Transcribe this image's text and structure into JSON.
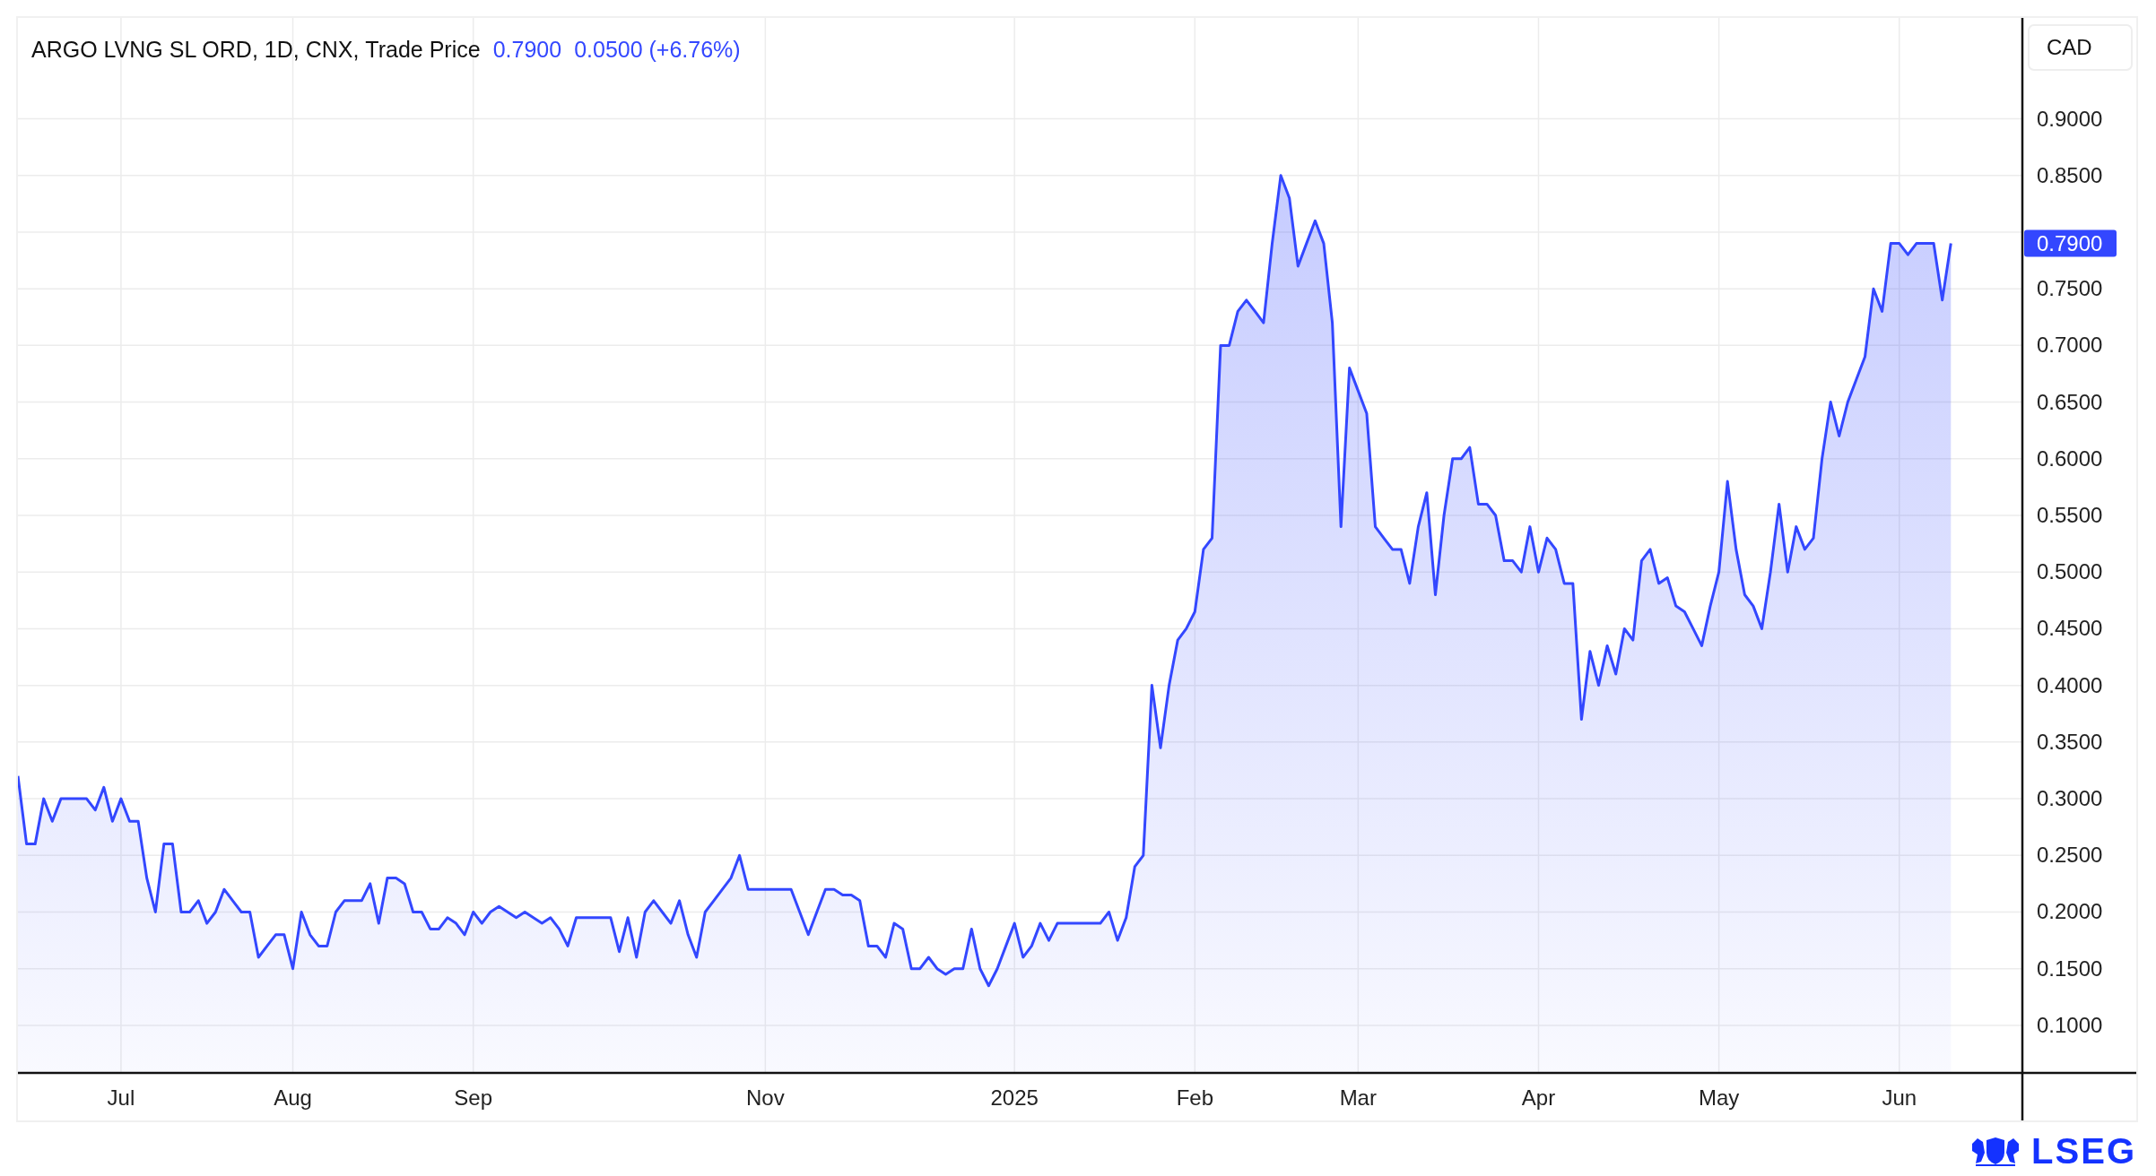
{
  "header": {
    "title": "ARGO LVNG SL ORD, 1D, CNX,",
    "last": "0.7900",
    "change": "0.0500 (+6.76%)"
  },
  "currency": "CAD",
  "price_label": "0.7900",
  "chart_data": {
    "type": "area",
    "grid": true,
    "ylim": [
      0.058,
      0.989
    ],
    "categories": [
      null,
      null,
      null,
      null,
      null,
      null,
      null,
      null,
      null,
      null,
      null,
      null,
      "Jul",
      null,
      null,
      null,
      null,
      null,
      null,
      null,
      null,
      null,
      null,
      null,
      null,
      null,
      null,
      null,
      null,
      null,
      null,
      null,
      "Aug",
      null,
      null,
      null,
      null,
      null,
      null,
      null,
      null,
      null,
      null,
      null,
      null,
      null,
      null,
      null,
      null,
      null,
      null,
      null,
      null,
      "Sep",
      null,
      null,
      null,
      null,
      null,
      null,
      null,
      null,
      null,
      null,
      null,
      null,
      null,
      null,
      null,
      null,
      null,
      null,
      null,
      null,
      null,
      null,
      null,
      null,
      null,
      null,
      null,
      null,
      null,
      null,
      null,
      null,
      null,
      "Nov",
      null,
      null,
      null,
      null,
      null,
      null,
      null,
      null,
      null,
      null,
      null,
      null,
      null,
      null,
      null,
      null,
      null,
      null,
      null,
      null,
      null,
      null,
      null,
      null,
      null,
      null,
      null,
      null,
      "2025",
      null,
      null,
      null,
      null,
      null,
      null,
      null,
      null,
      null,
      null,
      null,
      null,
      null,
      null,
      null,
      null,
      null,
      null,
      null,
      null,
      "Feb",
      null,
      null,
      null,
      null,
      null,
      null,
      null,
      null,
      null,
      null,
      null,
      null,
      null,
      null,
      null,
      null,
      null,
      null,
      "Mar",
      null,
      null,
      null,
      null,
      null,
      null,
      null,
      null,
      null,
      null,
      null,
      null,
      null,
      null,
      null,
      null,
      null,
      null,
      null,
      null,
      "Apr",
      null,
      null,
      null,
      null,
      null,
      null,
      null,
      null,
      null,
      null,
      null,
      null,
      null,
      null,
      null,
      null,
      null,
      null,
      null,
      null,
      "May",
      null,
      null,
      null,
      null,
      null,
      null,
      null,
      null,
      null,
      null,
      null,
      null,
      null,
      null,
      null,
      null,
      null,
      null,
      null,
      null,
      "Jun",
      null,
      null,
      null,
      null,
      null,
      null
    ],
    "yticks": [
      {
        "value": 0.1,
        "label": "0.1000"
      },
      {
        "value": 0.15,
        "label": "0.1500"
      },
      {
        "value": 0.2,
        "label": "0.2000"
      },
      {
        "value": 0.25,
        "label": "0.2500"
      },
      {
        "value": 0.3,
        "label": "0.3000"
      },
      {
        "value": 0.35,
        "label": "0.3500"
      },
      {
        "value": 0.4,
        "label": "0.4000"
      },
      {
        "value": 0.45,
        "label": "0.4500"
      },
      {
        "value": 0.5,
        "label": "0.5000"
      },
      {
        "value": 0.55,
        "label": "0.5500"
      },
      {
        "value": 0.6,
        "label": "0.6000"
      },
      {
        "value": 0.65,
        "label": "0.6500"
      },
      {
        "value": 0.7,
        "label": "0.7000"
      },
      {
        "value": 0.75,
        "label": "0.7500"
      },
      {
        "value": 0.85,
        "label": "0.8500"
      },
      {
        "value": 0.9,
        "label": "0.9000"
      }
    ],
    "series": [
      {
        "name": "Trade Price",
        "color": "#3347ff",
        "values": [
          0.32,
          0.26,
          0.26,
          0.3,
          0.28,
          0.3,
          0.3,
          0.3,
          0.3,
          0.29,
          0.31,
          0.28,
          0.3,
          0.28,
          0.28,
          0.23,
          0.2,
          0.26,
          0.26,
          0.2,
          0.2,
          0.21,
          0.19,
          0.2,
          0.22,
          0.21,
          0.2,
          0.2,
          0.16,
          0.17,
          0.18,
          0.18,
          0.15,
          0.2,
          0.18,
          0.17,
          0.17,
          0.2,
          0.21,
          0.21,
          0.21,
          0.225,
          0.19,
          0.23,
          0.23,
          0.225,
          0.2,
          0.2,
          0.185,
          0.185,
          0.195,
          0.19,
          0.18,
          0.2,
          0.19,
          0.2,
          0.205,
          0.2,
          0.195,
          0.2,
          0.195,
          0.19,
          0.195,
          0.185,
          0.17,
          0.195,
          0.195,
          0.195,
          0.195,
          0.195,
          0.165,
          0.195,
          0.16,
          0.2,
          0.21,
          0.2,
          0.19,
          0.21,
          0.18,
          0.16,
          0.2,
          0.21,
          0.22,
          0.23,
          0.25,
          0.22,
          0.22,
          0.22,
          0.22,
          0.22,
          0.22,
          0.2,
          0.18,
          0.2,
          0.22,
          0.22,
          0.215,
          0.215,
          0.21,
          0.17,
          0.17,
          0.16,
          0.19,
          0.185,
          0.15,
          0.15,
          0.16,
          0.15,
          0.145,
          0.15,
          0.15,
          0.185,
          0.15,
          0.135,
          0.15,
          0.17,
          0.19,
          0.16,
          0.17,
          0.19,
          0.175,
          0.19,
          0.19,
          0.19,
          0.19,
          0.19,
          0.19,
          0.2,
          0.175,
          0.195,
          0.24,
          0.25,
          0.4,
          0.345,
          0.4,
          0.44,
          0.45,
          0.465,
          0.52,
          0.53,
          0.7,
          0.7,
          0.73,
          0.74,
          0.73,
          0.72,
          0.79,
          0.85,
          0.83,
          0.77,
          0.79,
          0.81,
          0.79,
          0.72,
          0.54,
          0.68,
          0.66,
          0.64,
          0.54,
          0.53,
          0.52,
          0.52,
          0.49,
          0.54,
          0.57,
          0.48,
          0.55,
          0.6,
          0.6,
          0.61,
          0.56,
          0.56,
          0.55,
          0.51,
          0.51,
          0.5,
          0.54,
          0.5,
          0.53,
          0.52,
          0.49,
          0.49,
          0.37,
          0.43,
          0.4,
          0.435,
          0.41,
          0.45,
          0.44,
          0.51,
          0.52,
          0.49,
          0.495,
          0.47,
          0.465,
          0.45,
          0.435,
          0.47,
          0.5,
          0.58,
          0.52,
          0.48,
          0.47,
          0.45,
          0.5,
          0.56,
          0.5,
          0.54,
          0.52,
          0.53,
          0.6,
          0.65,
          0.62,
          0.65,
          0.67,
          0.69,
          0.75,
          0.73,
          0.79,
          0.79,
          0.78,
          0.79,
          0.79,
          0.79,
          0.74,
          0.79
        ]
      }
    ]
  },
  "logo": {
    "text": "LSEG"
  }
}
